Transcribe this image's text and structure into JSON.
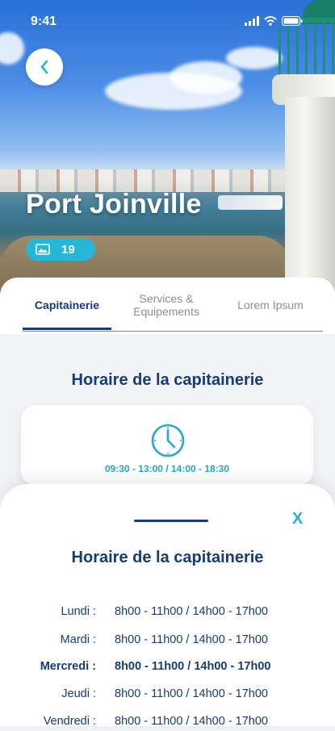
{
  "status_bar": {
    "time": "9:41"
  },
  "header": {
    "title": "Port Joinville",
    "photo_count": "19"
  },
  "tabs": [
    {
      "label": "Capitainerie",
      "active": true
    },
    {
      "label": "Services &\nEquipements",
      "active": false
    },
    {
      "label": "Lorem Ipsum",
      "active": false
    }
  ],
  "main": {
    "section_title": "Horaire de la capitainerie",
    "card_hours": "09:30 - 13:00 / 14:00 - 18:30"
  },
  "sheet": {
    "close_label": "X",
    "title": "Horaire de la capitainerie",
    "schedule": [
      {
        "day": "Lundi :",
        "hours": "8h00 - 11h00 / 14h00 - 17h00",
        "current": false
      },
      {
        "day": "Mardi :",
        "hours": "8h00 - 11h00 / 14h00 - 17h00",
        "current": false
      },
      {
        "day": "Mercredi :",
        "hours": "8h00 - 11h00 / 14h00 - 17h00",
        "current": true
      },
      {
        "day": "Jeudi :",
        "hours": "8h00 - 11h00 / 14h00 - 17h00",
        "current": false
      },
      {
        "day": "Vendredi :",
        "hours": "8h00 - 11h00 / 14h00 - 17h00",
        "current": false
      }
    ]
  },
  "colors": {
    "navy": "#163a7a",
    "accent": "#26b7d6",
    "lighthouse_green": "#1f8f78"
  },
  "icons": {
    "back": "chevron-left-icon",
    "gallery": "image-icon",
    "clock": "clock-icon"
  }
}
